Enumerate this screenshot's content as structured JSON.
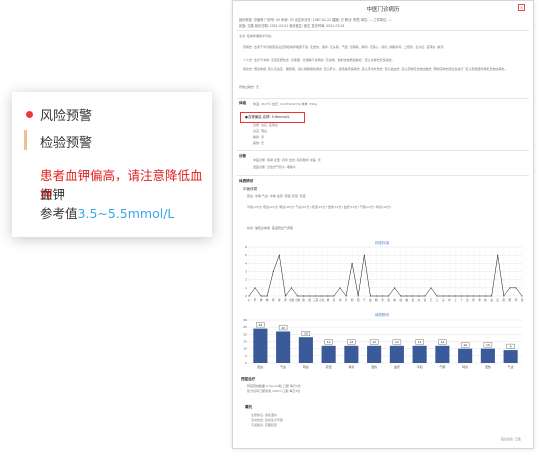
{
  "document": {
    "title": "中医门诊病历",
    "close": "×",
    "info_rows": [
      "就诊科室: 中医科    门诊号: 00    年龄: 33    出生年月日: 1987-02-22    婚姻: 已    职业: 职员    单位: —    工作单位: —",
      "民族: 汉族    就诊日期: 2021-03-01    就诊医生: 医生    复诊时间: 2021-03-01"
    ],
    "complaint": "主诉: 咳嗽伴咽痛半月余。",
    "history_paras": [
      "现病史: 患者于半月前受凉后出现咳嗽伴咽痛不适, 无发热、畏寒, 无头痛、气促, 无胸痛、胸闷, 无恶心、呕吐, 纳眠尚可, 二便调。舌淡红, 苔薄白, 脉浮。",
      "个人史: 生长于本地, 无疫区居住史, 无吸烟、饮酒等不良嗜好, 无毒物、放射性物质接触史。否认冶游史及性病史。",
      "既往史: 既往体健, 否认高血压、糖尿病、冠心病等慢性病史, 否认肝炎、结核等传染病史, 否认手术外伤史, 否认输血史, 否认药物及食物过敏史, 预防接种史随社会进行, 否认家族遗传病史及类似病史。"
    ],
    "allergy": "药物过敏史: 无",
    "exam_section": "体格",
    "vitals": "体温: 36.5℃    血压: 110/70mmHg    体重: 55kg",
    "alert_label": "●血钾偏高",
    "alert_value": "血钾: 5.8mmol/L",
    "tongue_rows": [
      "舌质: 淡红, 苔薄白",
      "舌苔: 薄白",
      "脉象: 浮",
      "其他: 无"
    ],
    "diagnosis_section": "诊断",
    "diag_rows": [
      "中医诊断: 咳嗽    证型: 风寒    治法: 疏风散寒    中医: 无",
      "西医诊断: 急性支气管炎, 咽喉炎"
    ],
    "constitution_section": "体质辨识",
    "constitution_sub": "中医体质",
    "constitution_rows": [
      "阳虚: 中等    气虚: 中等    血瘀: 轻度    痰湿: 轻度",
      "平和(15分)    阳虚(22分)    阴虚(18分)    气虚(20分)    痰湿(15分)    湿热(12分)    血瘀(14分)    气郁(13分)    特禀(10分)",
      "综合: 偏阳虚体质, 需温阳益气调理"
    ],
    "chart1_title": "判定标准",
    "chart2_title": "体质辨识",
    "treatment_section": "西医治疗",
    "treatment_rows": [
      "阿莫西林胶囊 0.5g×24粒 口服 每日3次",
      "复方甘草口服溶液 100ml 口服 每日3次"
    ],
    "advice_section": "嘱托",
    "advice_rows": [
      "注意休息, 多饮温水",
      "清淡饮食, 忌食生冷辛辣",
      "不适随诊, 定期复查"
    ],
    "footer": "医生签名: 王医"
  },
  "popup": {
    "item1": "风险预警",
    "item2": "检验预警",
    "warning": "患者血钾偏高，请注意降低血钾",
    "indicator": "血钾",
    "ref_label": "参考值",
    "ref_value": "3.5~5.5mmol/L"
  },
  "chart_data": [
    {
      "type": "line",
      "title": "判定标准",
      "ylim": [
        0,
        6
      ],
      "yticks": [
        0,
        1,
        2,
        3,
        4,
        5,
        6
      ],
      "x": [
        "心",
        "肝",
        "脾",
        "肺",
        "肾",
        "胃",
        "胆",
        "大肠",
        "小肠",
        "膀",
        "胱",
        "三焦",
        "心包",
        "督",
        "任",
        "冲",
        "带",
        "阴",
        "阳",
        "气",
        "血",
        "精",
        "津",
        "液",
        "神",
        "魂",
        "魄",
        "意",
        "志",
        "营",
        "卫",
        "元",
        "宗",
        "中",
        "上",
        "下",
        "表",
        "里",
        "寒",
        "热",
        "虚",
        "实",
        "阴",
        "阳",
        "风",
        "湿"
      ],
      "values": [
        0,
        1,
        0,
        0,
        3,
        5,
        0,
        1,
        0,
        0,
        0,
        0,
        0,
        0,
        0,
        1,
        0,
        4,
        0,
        5,
        0,
        0,
        0,
        0,
        1,
        0,
        0,
        0,
        0,
        0,
        1,
        0,
        0,
        0,
        0,
        0,
        0,
        0,
        0,
        0,
        0,
        5,
        0,
        1,
        1,
        0
      ]
    },
    {
      "type": "bar",
      "title": "体质辨识",
      "ylim": [
        0,
        30
      ],
      "yticks": [
        0,
        5,
        10,
        15,
        20,
        25,
        30
      ],
      "categories": [
        "阳虚",
        "气虚",
        "阴虚",
        "痰湿",
        "特禀",
        "湿热",
        "血瘀",
        "平和",
        "气郁",
        "特禀",
        "湿热",
        "气虚"
      ],
      "values": [
        24,
        22,
        18,
        12,
        12,
        12,
        12,
        12,
        12,
        10,
        10,
        9
      ],
      "bar_color": "#3b5a9a"
    }
  ]
}
